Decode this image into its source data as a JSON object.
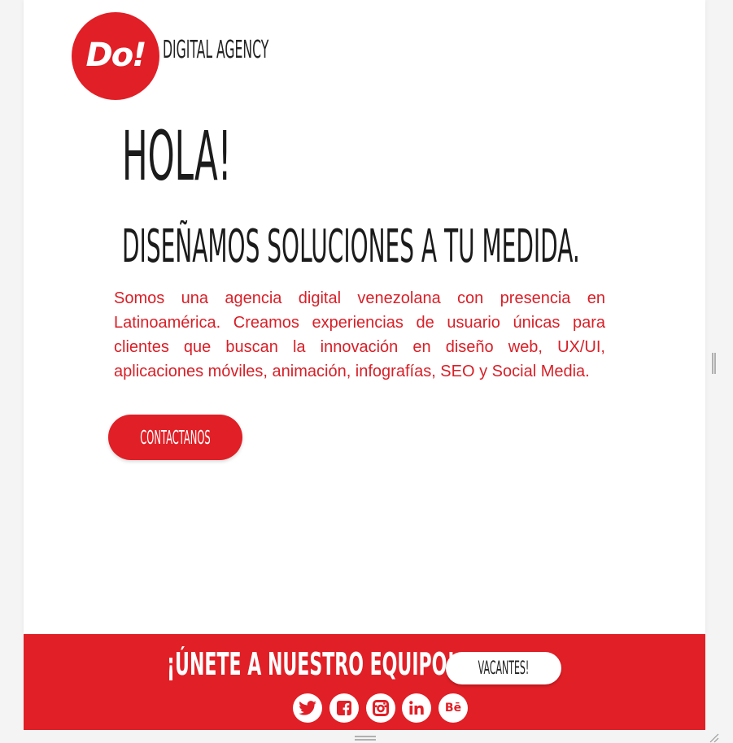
{
  "header": {
    "logo_text": "Do!",
    "agency_label": "DIGITAL AGENCY"
  },
  "hero": {
    "greeting": "HOLA!",
    "tagline": "DISEÑAMOS SOLUCIONES A TU MEDIDA.",
    "description": "Somos una agencia digital venezolana con presencia en Latinoamérica. Creamos experiencias de usuario únicas para clientes que buscan la innovación en diseño web, UX/UI, aplicaciones móviles, animación, infografías, SEO y Social Media.",
    "cta_label": "CONTACTANOS"
  },
  "footer": {
    "join_text": "¡ÚNETE A NUESTRO EQUIPO!",
    "vacancies_label": "VACANTES!",
    "social": [
      {
        "name": "twitter-icon"
      },
      {
        "name": "facebook-icon"
      },
      {
        "name": "instagram-icon"
      },
      {
        "name": "linkedin-icon"
      },
      {
        "name": "behance-icon",
        "text": "Bē"
      }
    ]
  },
  "colors": {
    "brand_red": "#e11f26",
    "text_dark": "#1b1b1b",
    "description_red": "#d81f27",
    "white": "#ffffff"
  }
}
